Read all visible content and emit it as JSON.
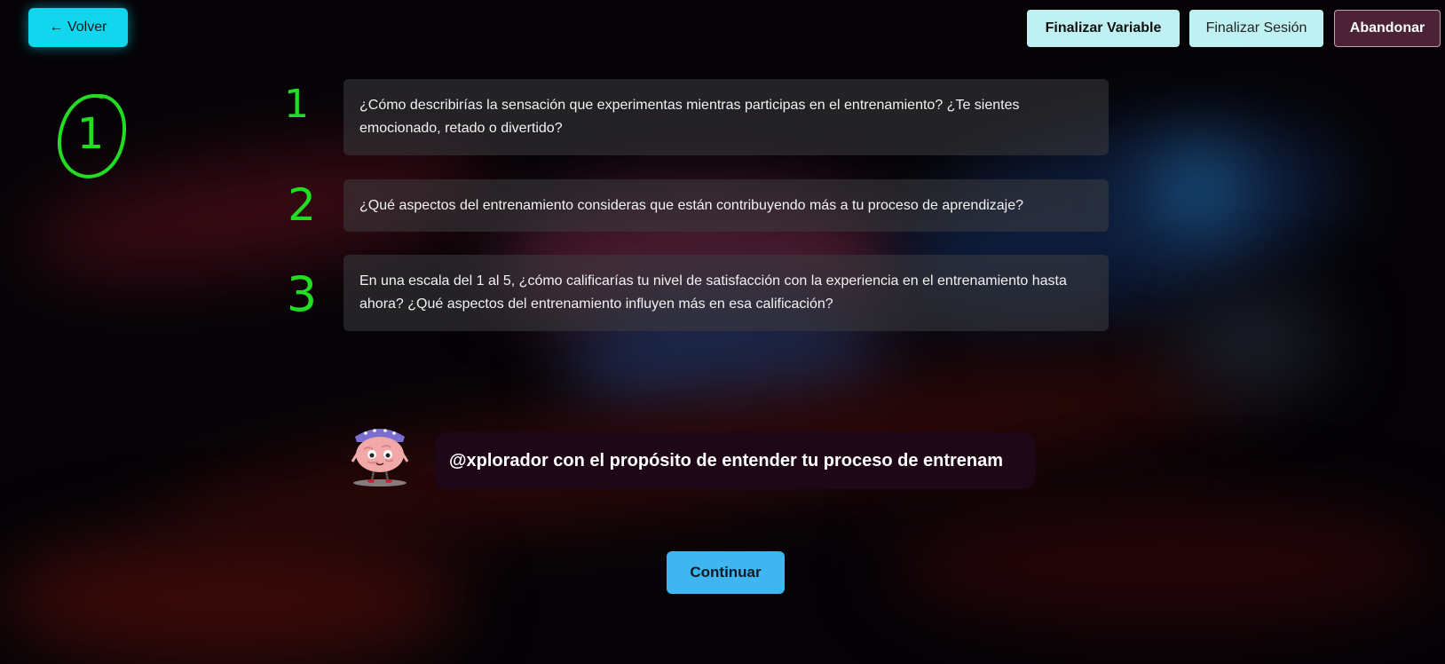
{
  "header": {
    "back_label": "← Volver",
    "finalize_variable_label": "Finalizar Variable",
    "finalize_session_label": "Finalizar Sesión",
    "abandon_label": "Abandonar"
  },
  "annotations": {
    "circled": "1",
    "numbers": [
      "1",
      "2",
      "3"
    ],
    "color": "#22dd22"
  },
  "questions": [
    "¿Cómo describirías la sensación que experimentas mientras participas en el entrenamiento? ¿Te sientes emocionado, retado o divertido?",
    "¿Qué aspectos del entrenamiento consideras que están contribuyendo más a tu proceso de aprendizaje?",
    "En una escala del 1 al 5, ¿cómo calificarías tu nivel de satisfacción con la experiencia en el entrenamiento hasta ahora? ¿Qué aspectos del entrenamiento influyen más en esa calificación?"
  ],
  "assistant": {
    "avatar_icon": "brain-mascot-icon",
    "message": "@xplorador con el propósito de entender tu proceso de entrenam"
  },
  "footer": {
    "continue_label": "Continuar"
  },
  "colors": {
    "back_button": "#12d6ee",
    "finalize_buttons": "#bff1f3",
    "abandon_button": "#4c2236",
    "continue_button": "#3fb6f0",
    "bubble": "#1e0716"
  }
}
